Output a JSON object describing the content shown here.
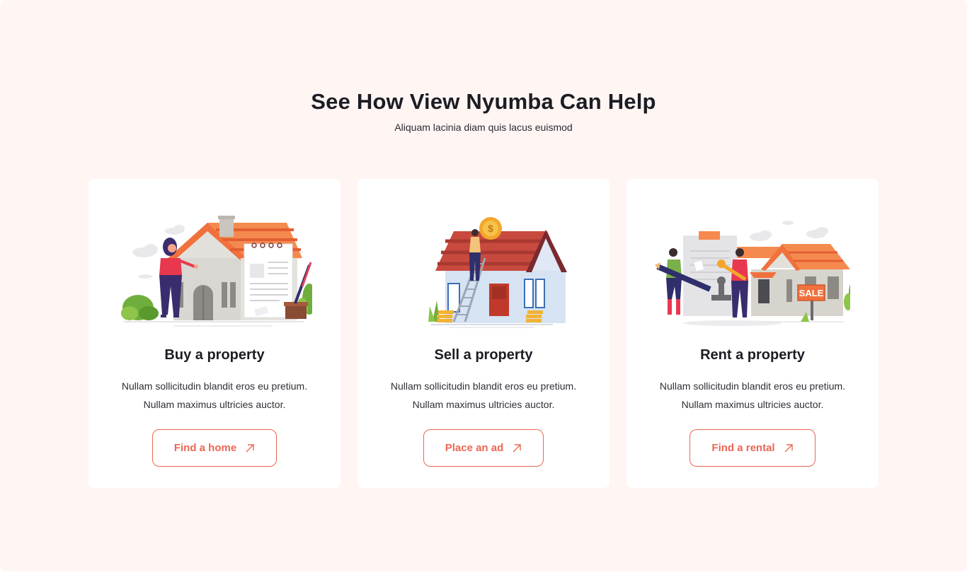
{
  "section": {
    "title": "See How View Nyumba Can Help",
    "subtitle": "Aliquam lacinia diam quis lacus euismod"
  },
  "cards": [
    {
      "title": "Buy a property",
      "text_line1": "Nullam sollicitudin blandit eros eu pretium.",
      "text_line2": "Nullam maximus ultricies auctor.",
      "button_label": "Find a home",
      "illustration": "house-buyer-illustration"
    },
    {
      "title": "Sell a property",
      "text_line1": "Nullam sollicitudin blandit eros eu pretium.",
      "text_line2": "Nullam maximus ultricies auctor.",
      "button_label": "Place an ad",
      "illustration": "house-seller-illustration"
    },
    {
      "title": "Rent a property",
      "text_line1": "Nullam sollicitudin blandit eros eu pretium.",
      "text_line2": "Nullam maximus ultricies auctor.",
      "button_label": "Find a rental",
      "illustration": "house-rental-illustration",
      "sign_text": "SALE"
    }
  ],
  "colors": {
    "accent": "#eb6753",
    "background": "#fff5f3",
    "card": "#ffffff",
    "text": "#1c1c24"
  },
  "icons": {
    "button_icon": "arrow-up-right-icon"
  }
}
